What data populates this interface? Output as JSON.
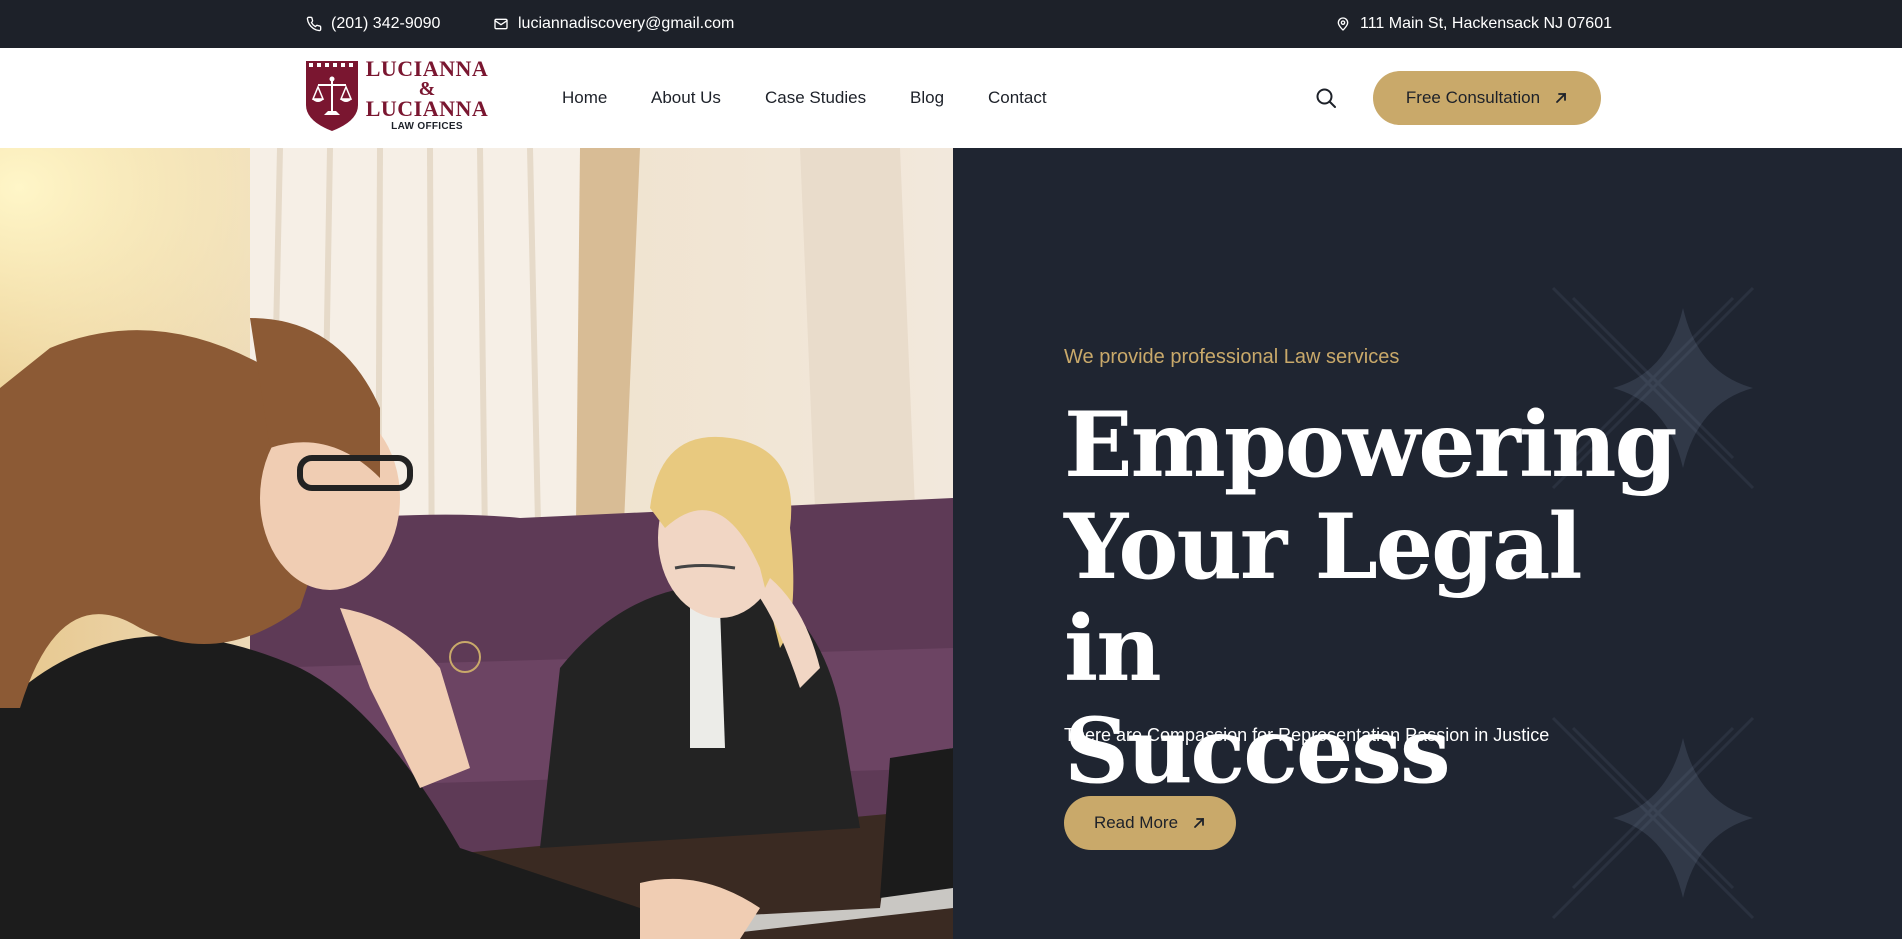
{
  "topbar": {
    "phone": "(201) 342-9090",
    "email": "luciannadiscovery@gmail.com",
    "address": "111 Main St, Hackensack NJ 07601"
  },
  "logo": {
    "line1": "LUCIANNA",
    "line2": "&",
    "line3": "LUCIANNA",
    "line4": "LAW OFFICES"
  },
  "nav": {
    "items": [
      {
        "label": "Home"
      },
      {
        "label": "About Us"
      },
      {
        "label": "Case Studies"
      },
      {
        "label": "Blog"
      },
      {
        "label": "Contact"
      }
    ]
  },
  "header": {
    "cta_label": "Free Consultation",
    "search_icon": "search-icon"
  },
  "hero": {
    "tagline": "We provide professional Law services",
    "headline_line1": "Empowering",
    "headline_line2": "Your Legal in",
    "headline_line3": "Success",
    "subtext": "There are Compassion for Representation Passion in Justice",
    "button_label": "Read More"
  },
  "colors": {
    "accent": "#c9a96a",
    "dark": "#1f2531",
    "topbar": "#1d2129",
    "brand": "#7a1630"
  }
}
